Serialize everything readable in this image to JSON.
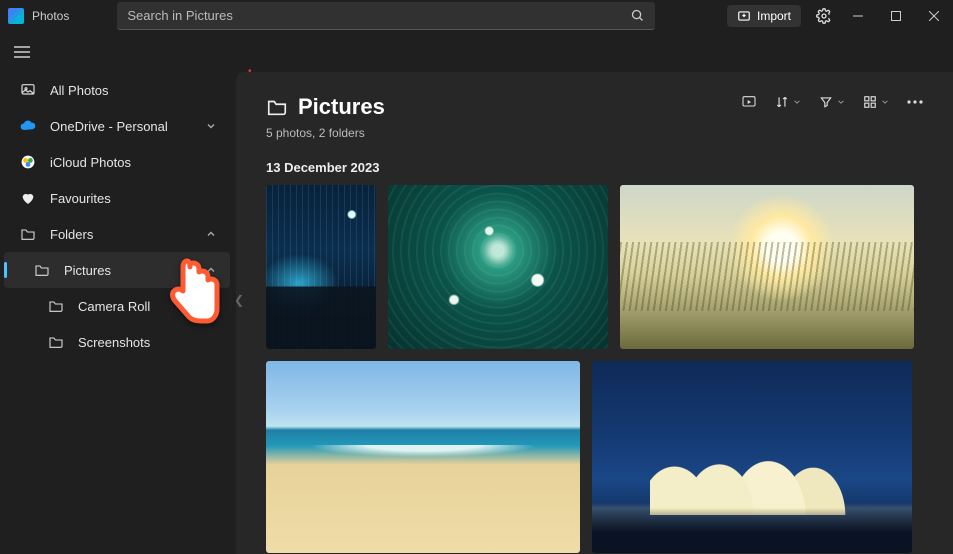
{
  "app": {
    "name": "Photos"
  },
  "search": {
    "placeholder": "Search in Pictures"
  },
  "import": {
    "label": "Import"
  },
  "sidebar": {
    "all_photos": "All Photos",
    "onedrive": "OneDrive - Personal",
    "icloud": "iCloud Photos",
    "favourites": "Favourites",
    "folders": "Folders",
    "pictures": "Pictures",
    "camera_roll": "Camera Roll",
    "screenshots": "Screenshots"
  },
  "page": {
    "title": "Pictures",
    "subtitle": "5 photos, 2 folders",
    "date_group": "13 December 2023"
  },
  "thumbnails": [
    {
      "name": "sydney-harbour-bridge-night"
    },
    {
      "name": "aerial-ocean-waves"
    },
    {
      "name": "sunset-grass-beach"
    },
    {
      "name": "bondi-beach-day"
    },
    {
      "name": "sydney-opera-house-night"
    }
  ],
  "icons": {
    "import": "import-icon",
    "settings": "gear-icon",
    "search": "search-icon"
  }
}
